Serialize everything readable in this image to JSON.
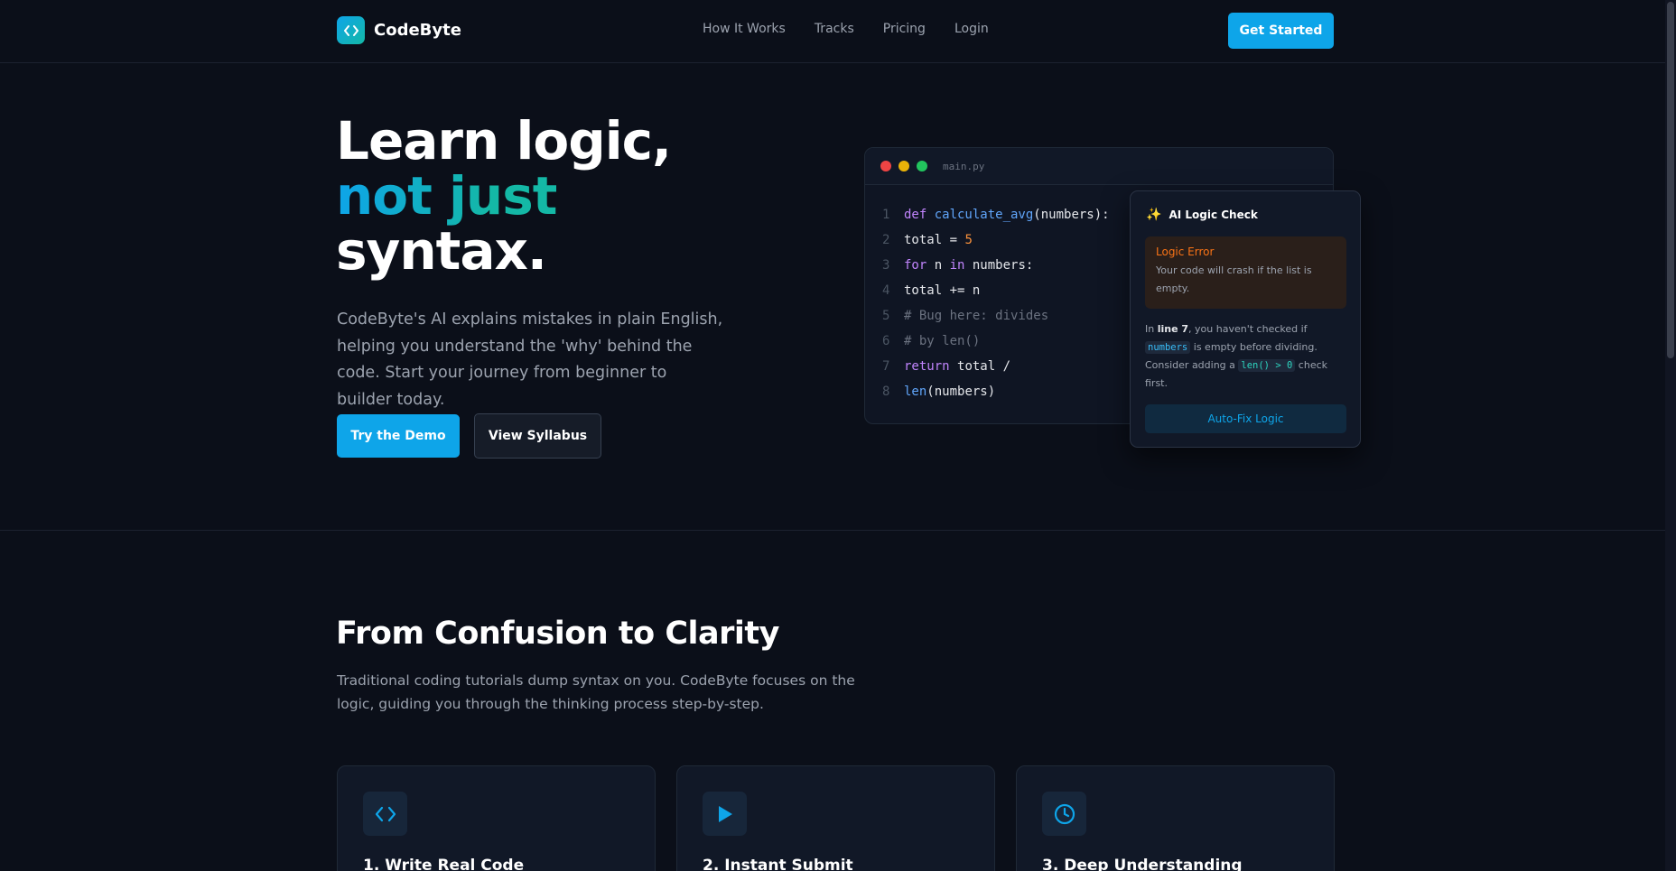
{
  "brand": {
    "name": "CodeByte",
    "logo_icon": "code-brackets-icon"
  },
  "nav": {
    "items": [
      {
        "label": "How It Works"
      },
      {
        "label": "Tracks"
      },
      {
        "label": "Pricing"
      },
      {
        "label": "Login"
      }
    ]
  },
  "header": {
    "cta_label": "Get Started"
  },
  "hero": {
    "title_line1": "Learn logic,",
    "title_line2": "not just",
    "title_line3": "syntax.",
    "subtitle": "CodeByte's AI explains mistakes in plain English, helping you understand the 'why' behind the code. Start your journey from beginner to builder today.",
    "primary_button": "Try the Demo",
    "secondary_button": "View Syllabus"
  },
  "editor": {
    "filename": "main.py",
    "lines": [
      {
        "num": "1",
        "tokens": [
          {
            "t": "def ",
            "c": "kw"
          },
          {
            "t": "calculate_avg",
            "c": "fn"
          },
          {
            "t": "(numbers):",
            "c": ""
          }
        ]
      },
      {
        "num": "2",
        "tokens": [
          {
            "t": "total = ",
            "c": ""
          },
          {
            "t": "5",
            "c": "num"
          }
        ]
      },
      {
        "num": "3",
        "tokens": [
          {
            "t": "for ",
            "c": "kw"
          },
          {
            "t": "n ",
            "c": ""
          },
          {
            "t": "in ",
            "c": "kw"
          },
          {
            "t": "numbers:",
            "c": ""
          }
        ]
      },
      {
        "num": "4",
        "tokens": [
          {
            "t": "total += n",
            "c": ""
          }
        ]
      },
      {
        "num": "5",
        "tokens": [
          {
            "t": "# Bug here: divides",
            "c": "cm"
          }
        ]
      },
      {
        "num": "6",
        "tokens": [
          {
            "t": "# by len()",
            "c": "cm"
          }
        ]
      },
      {
        "num": "7",
        "tokens": [
          {
            "t": "return ",
            "c": "kw"
          },
          {
            "t": "total /",
            "c": ""
          }
        ]
      },
      {
        "num": "8",
        "tokens": [
          {
            "t": "len",
            "c": "fn"
          },
          {
            "t": "(numbers)",
            "c": ""
          }
        ]
      }
    ]
  },
  "ai_panel": {
    "title": "AI Logic Check",
    "icon": "sparkles-icon",
    "error_title": "Logic Error",
    "error_text": "Your code will crash if the list is empty.",
    "body_1": "In ",
    "body_line": "line 7",
    "body_2": ", you haven't checked if ",
    "body_code1": "numbers",
    "body_3": " is empty before dividing. Consider adding a ",
    "body_code2": "len() > 0",
    "body_4": " check first.",
    "button": "Auto-Fix Logic"
  },
  "section": {
    "title": "From Confusion to Clarity",
    "description": "Traditional coding tutorials dump syntax on you. CodeByte focuses on the logic, guiding you through the thinking process step-by-step.",
    "cards": [
      {
        "title": "1. Write Real Code",
        "icon": "code-brackets-icon"
      },
      {
        "title": "2. Instant Submit",
        "icon": "play-icon"
      },
      {
        "title": "3. Deep Understanding",
        "icon": "clock-icon"
      }
    ]
  },
  "colors": {
    "accent": "#0ea5e9",
    "teal": "#14b8a6",
    "background": "#0b0f19",
    "error": "#f97316"
  }
}
